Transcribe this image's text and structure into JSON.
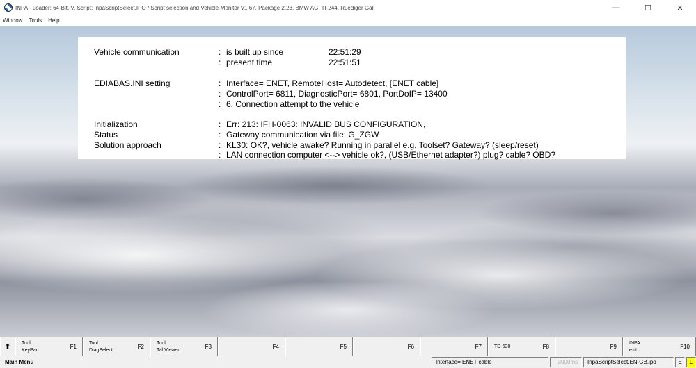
{
  "window": {
    "title": "INPA - Loader:  64-Bit, V, Script: InpaScriptSelect.IPO / Script selection and Vehicle-Monitor V1.67, Package 2.23, BMW AG, TI-244, Ruediger Gall",
    "minimize": "—",
    "maximize": "☐",
    "close": "✕"
  },
  "menu": {
    "items": [
      "Window",
      "Tools",
      "Help"
    ]
  },
  "info": {
    "vehicle_comm_label": "Vehicle communication",
    "built_up_label": "is built up since",
    "built_up_time": "22:51:29",
    "present_label": "present time",
    "present_time": "22:51:51",
    "ediabas_label": "EDIABAS.INI setting",
    "ediabas_line1": "Interface= ENET, RemoteHost= Autodetect, [ENET cable]",
    "ediabas_line2": "ControlPort= 6811, DiagnosticPort= 6801, PortDoIP= 13400",
    "ediabas_line3": "6. Connection attempt to the vehicle",
    "init_label": "Initialization",
    "init_value": "Err: 213: IFH-0063: INVALID BUS CONFIGURATION,",
    "status_label": "Status",
    "status_value": "Gateway communication via file: G_ZGW",
    "solution_label": "Solution approach",
    "solution_line1": "KL30: OK?, vehicle awake? Running in parallel e.g. Toolset? Gateway? (sleep/reset)",
    "solution_line2": "LAN connection computer <--> vehicle ok?, (USB/Ethernet adapter?) plug? cable? OBD?",
    "colon": ":"
  },
  "fkeys": {
    "up_arrow": "⬆",
    "keys": [
      {
        "line1": "Tool",
        "line2": "KeyPad",
        "fn": "F1"
      },
      {
        "line1": "Tool",
        "line2": "DiagSelect",
        "fn": "F2"
      },
      {
        "line1": "Tool",
        "line2": "TabViewer",
        "fn": "F3"
      },
      {
        "line1": "",
        "line2": "",
        "fn": "F4"
      },
      {
        "line1": "",
        "line2": "",
        "fn": "F5"
      },
      {
        "line1": "",
        "line2": "",
        "fn": "F6"
      },
      {
        "line1": "",
        "line2": "",
        "fn": "F7"
      },
      {
        "line1": "TD-530",
        "line2": "",
        "fn": "F8"
      },
      {
        "line1": "",
        "line2": "",
        "fn": "F9"
      },
      {
        "line1": "INPA",
        "line2": "exit",
        "fn": "F10"
      }
    ]
  },
  "statusbar": {
    "main": "Main Menu",
    "interface": "Interface= ENET cable",
    "timing": "3000ms",
    "script": "InpaScriptSelect.EN-GB.ipo",
    "e_flag": "E",
    "l_flag": "L"
  },
  "colors": {
    "status_l_bg": "#ffff00",
    "logo_blue": "#1c69d4"
  }
}
